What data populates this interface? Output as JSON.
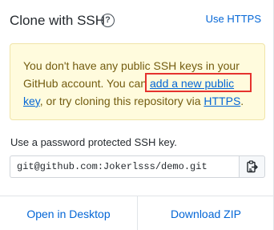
{
  "header": {
    "title": "Clone with SSH",
    "help_icon_glyph": "?",
    "use_https_label": "Use HTTPS"
  },
  "flash": {
    "text_before_link": "You don't have any public SSH keys in your GitHub account. You can ",
    "link_add_key": "add a new public key",
    "text_middle": ", or try cloning this repository via ",
    "link_https": "HTTPS",
    "text_end": "."
  },
  "clone": {
    "instruction": "Use a password protected SSH key.",
    "url": "git@github.com:Jokerlsss/demo.git",
    "copy_icon": "clipboard-icon"
  },
  "footer": {
    "open_desktop_label": "Open in Desktop",
    "download_zip_label": "Download ZIP"
  },
  "colors": {
    "link": "#0366d6",
    "flash_bg": "#fffbdd",
    "flash_text": "#735c0f",
    "highlight": "#e5322e"
  }
}
